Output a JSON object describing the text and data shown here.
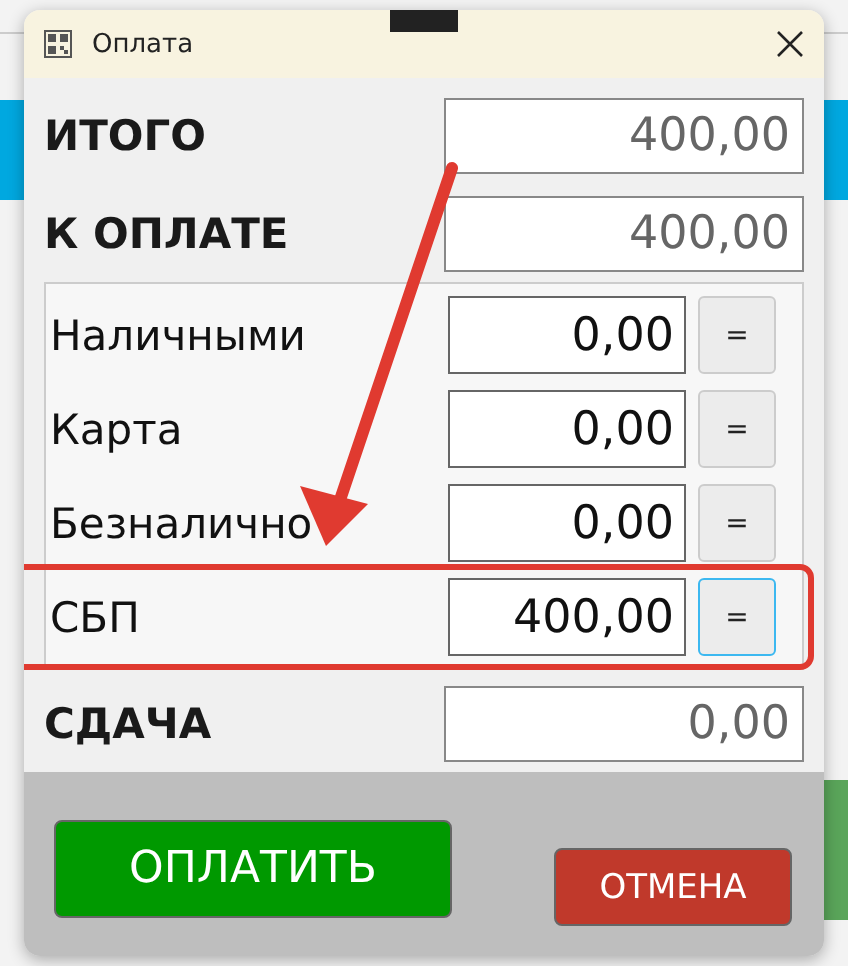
{
  "window": {
    "title": "Оплата"
  },
  "totals": [
    {
      "label": "ИТОГО",
      "value": "400,00"
    },
    {
      "label": "К ОПЛАТЕ",
      "value": "400,00"
    }
  ],
  "payments": [
    {
      "label": "Наличными",
      "value": "0,00",
      "button": "=",
      "focused": false,
      "highlighted": false
    },
    {
      "label": "Карта",
      "value": "0,00",
      "button": "=",
      "focused": false,
      "highlighted": false
    },
    {
      "label": "Безналично",
      "value": "0,00",
      "button": "=",
      "focused": false,
      "highlighted": false
    },
    {
      "label": "СБП",
      "value": "400,00",
      "button": "=",
      "focused": true,
      "highlighted": true
    }
  ],
  "change": {
    "label": "СДАЧА",
    "value": "0,00"
  },
  "buttons": [
    {
      "label": "ОПЛАТИТЬ",
      "kind": "primary"
    },
    {
      "label": "ОТМЕНА",
      "kind": "cancel"
    }
  ]
}
